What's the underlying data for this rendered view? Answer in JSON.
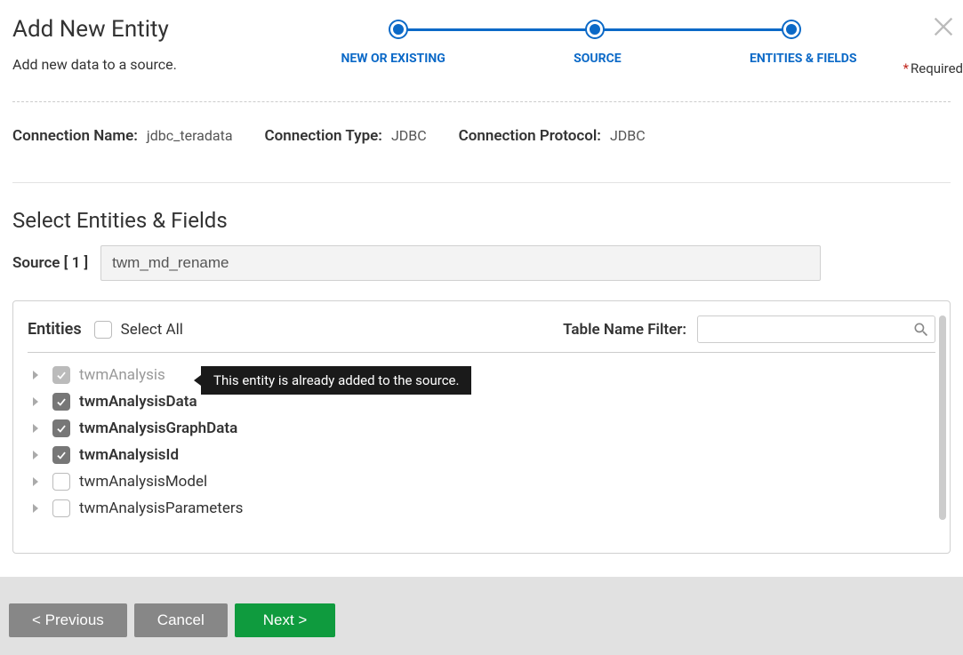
{
  "header": {
    "title": "Add New Entity",
    "subtitle": "Add new data to a source.",
    "required_label": "Required"
  },
  "steps": [
    {
      "label": "NEW OR EXISTING"
    },
    {
      "label": "SOURCE"
    },
    {
      "label": "ENTITIES & FIELDS"
    }
  ],
  "connection": {
    "name_label": "Connection Name:",
    "name_value": "jdbc_teradata",
    "type_label": "Connection Type:",
    "type_value": "JDBC",
    "protocol_label": "Connection Protocol:",
    "protocol_value": "JDBC"
  },
  "section": {
    "title": "Select Entities & Fields",
    "source_label": "Source [ 1 ]",
    "source_value": "twm_md_rename"
  },
  "entities_panel": {
    "title": "Entities",
    "select_all_label": "Select All",
    "filter_label": "Table Name Filter:",
    "filter_value": ""
  },
  "entities": [
    {
      "name": "twmAnalysis",
      "checked": true,
      "disabled": true,
      "bold": false
    },
    {
      "name": "twmAnalysisData",
      "checked": true,
      "disabled": false,
      "bold": true
    },
    {
      "name": "twmAnalysisGraphData",
      "checked": true,
      "disabled": false,
      "bold": true
    },
    {
      "name": "twmAnalysisId",
      "checked": true,
      "disabled": false,
      "bold": true
    },
    {
      "name": "twmAnalysisModel",
      "checked": false,
      "disabled": false,
      "bold": false
    },
    {
      "name": "twmAnalysisParameters",
      "checked": false,
      "disabled": false,
      "bold": false
    }
  ],
  "tooltip": {
    "text": "This entity is already added to the source."
  },
  "footer": {
    "previous": "< Previous",
    "cancel": "Cancel",
    "next": "Next >"
  }
}
